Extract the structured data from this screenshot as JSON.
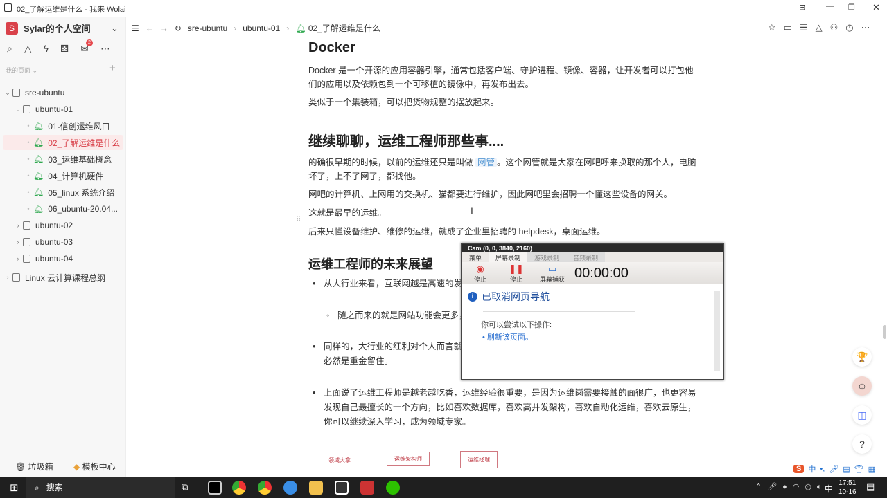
{
  "window": {
    "title": "02_了解运维是什么 - 我来 Wolai"
  },
  "sidebar": {
    "workspace_initial": "S",
    "workspace": "Sylar的个人空间",
    "section": "我的页面 ⌄",
    "tree": [
      {
        "label": "sre-ubuntu",
        "level": 0,
        "type": "page",
        "expanded": true
      },
      {
        "label": "ubuntu-01",
        "level": 1,
        "type": "page",
        "expanded": true
      },
      {
        "label": "01-信创运维风口",
        "level": 2,
        "type": "bell"
      },
      {
        "label": "02_了解运维是什么",
        "level": 2,
        "type": "bell",
        "selected": true
      },
      {
        "label": "03_运维基础概念",
        "level": 2,
        "type": "bell"
      },
      {
        "label": "04_计算机硬件",
        "level": 2,
        "type": "bell"
      },
      {
        "label": "05_linux 系统介绍",
        "level": 2,
        "type": "bell"
      },
      {
        "label": "06_ubuntu-20.04...",
        "level": 2,
        "type": "bell"
      },
      {
        "label": "ubuntu-02",
        "level": 1,
        "type": "page"
      },
      {
        "label": "ubuntu-03",
        "level": 1,
        "type": "page"
      },
      {
        "label": "ubuntu-04",
        "level": 1,
        "type": "page"
      },
      {
        "label": "Linux 云计算课程总纲",
        "level": 0,
        "type": "page"
      }
    ],
    "trash": "垃圾箱",
    "templates": "模板中心",
    "badge": "2"
  },
  "breadcrumb": [
    "sre-ubuntu",
    "ubuntu-01",
    "02_了解运维是什么"
  ],
  "doc": {
    "h_docker": "Docker",
    "p1": "Docker 是一个开源的应用容器引擎，通常包括客户端、守护进程、镜像、容器，让开发者可以打包他们的应用以及依赖包到一个可移植的镜像中，再发布出去。",
    "p2": "类似于一个集装箱，可以把货物规整的摆放起来。",
    "h_talk": "继续聊聊，运维工程师那些事....",
    "p3a": "的确很早期的时候，以前的运维还只是叫做 ",
    "p3tag": "网管",
    "p3b": "。这个网管就是大家在网吧呼来换取的那个人，电脑坏了，上不了网了，都找他。",
    "p4": "网吧的计算机、上网用的交换机、猫都要进行维护，因此网吧里会招聘一个懂这些设备的网关。",
    "p5": "这就是最早的运维。",
    "p6": "后来只懂设备维护、维修的运维，就成了企业里招聘的 helpdesk，桌面运维。",
    "h_future": "运维工程师的未来展望",
    "b1": "从大行业来看，互联网越是高速的发展……多，后天还会有更多的新势力。",
    "b1_1": "随之而来的就是网站功能会更多，……越高，特别是能力突出，优秀的运",
    "b2": "同样的，大行业的红利对个人而言就是……司，给的年终奖有多高，阳光普照奖都……人，公司也必然是重金留住。",
    "b3": "上面说了运维工程师是越老越吃香，运维经验很重要，是因为运维岗需要接触的面很广，也更容易发现自己最擅长的一个方向，比如喜欢数据库，喜欢高并发架构，喜欢自动化运维，喜欢云原生，你可以继续深入学习，成为领域专家。",
    "sketch": [
      "领域大拿",
      "运维架构师",
      "运维经理"
    ]
  },
  "cam": {
    "title": "Cam (0, 0, 3840, 2160)",
    "tabs": [
      "菜单",
      "屏幕录制",
      "游戏录制",
      "音频录制"
    ],
    "btns": [
      "停止",
      "停止",
      "屏幕捕获"
    ],
    "timer": "00:00:00",
    "nav_title": "已取消网页导航",
    "nav_hint": "你可以尝试以下操作:",
    "nav_link": "刷新该页面。"
  },
  "taskbar": {
    "search": "搜索",
    "time": "17:51",
    "date": "10-16",
    "ime": "中"
  }
}
